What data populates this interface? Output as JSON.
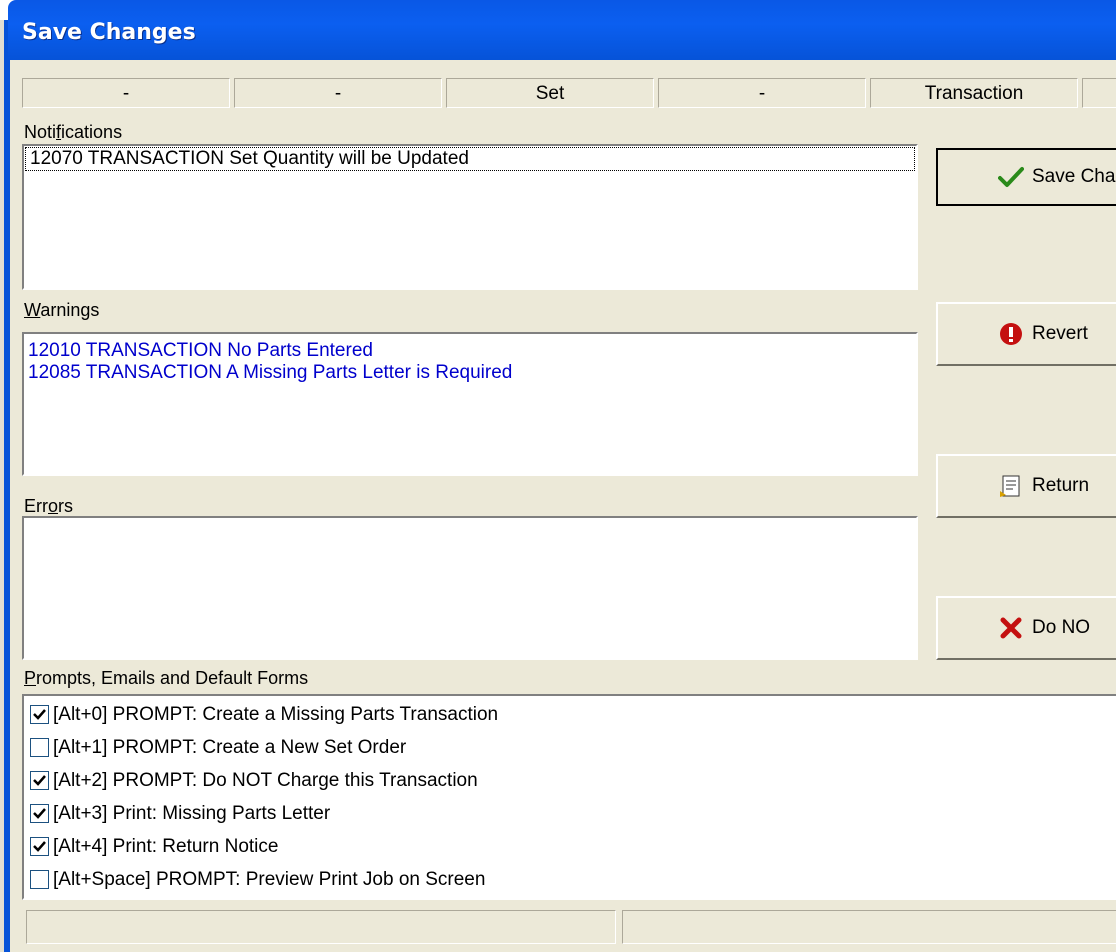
{
  "window": {
    "title": "Save Changes"
  },
  "header_cells": [
    "-",
    "-",
    "Set",
    "-",
    "Transaction",
    ""
  ],
  "notifications": {
    "label": "Notifications",
    "items": [
      "12070  TRANSACTION  Set Quantity will be Updated"
    ]
  },
  "warnings": {
    "label": "Warnings",
    "items": [
      "12010  TRANSACTION  No Parts Entered",
      "12085  TRANSACTION  A Missing Parts Letter is Required"
    ]
  },
  "errors": {
    "label": "Errors",
    "items": []
  },
  "buttons": {
    "save_changes": "Save Cha",
    "revert": "Revert",
    "return": "Return",
    "do_not": "Do NO"
  },
  "prompts": {
    "label": "Prompts, Emails and Default Forms",
    "items": [
      {
        "label": "[Alt+0] PROMPT: Create a Missing Parts Transaction",
        "checked": true
      },
      {
        "label": "[Alt+1] PROMPT: Create a New Set Order",
        "checked": false
      },
      {
        "label": "[Alt+2] PROMPT: Do NOT Charge this Transaction",
        "checked": true
      },
      {
        "label": "[Alt+3] Print: Missing Parts Letter",
        "checked": true
      },
      {
        "label": "[Alt+4] Print: Return Notice",
        "checked": true
      },
      {
        "label": "[Alt+Space] PROMPT: Preview Print Job on Screen",
        "checked": false
      }
    ]
  },
  "status_bar": [
    "",
    ""
  ],
  "colors": {
    "title_bar": "#0a58e6",
    "warning_text": "#0000cc",
    "dialog_bg": "#ece9d8"
  }
}
